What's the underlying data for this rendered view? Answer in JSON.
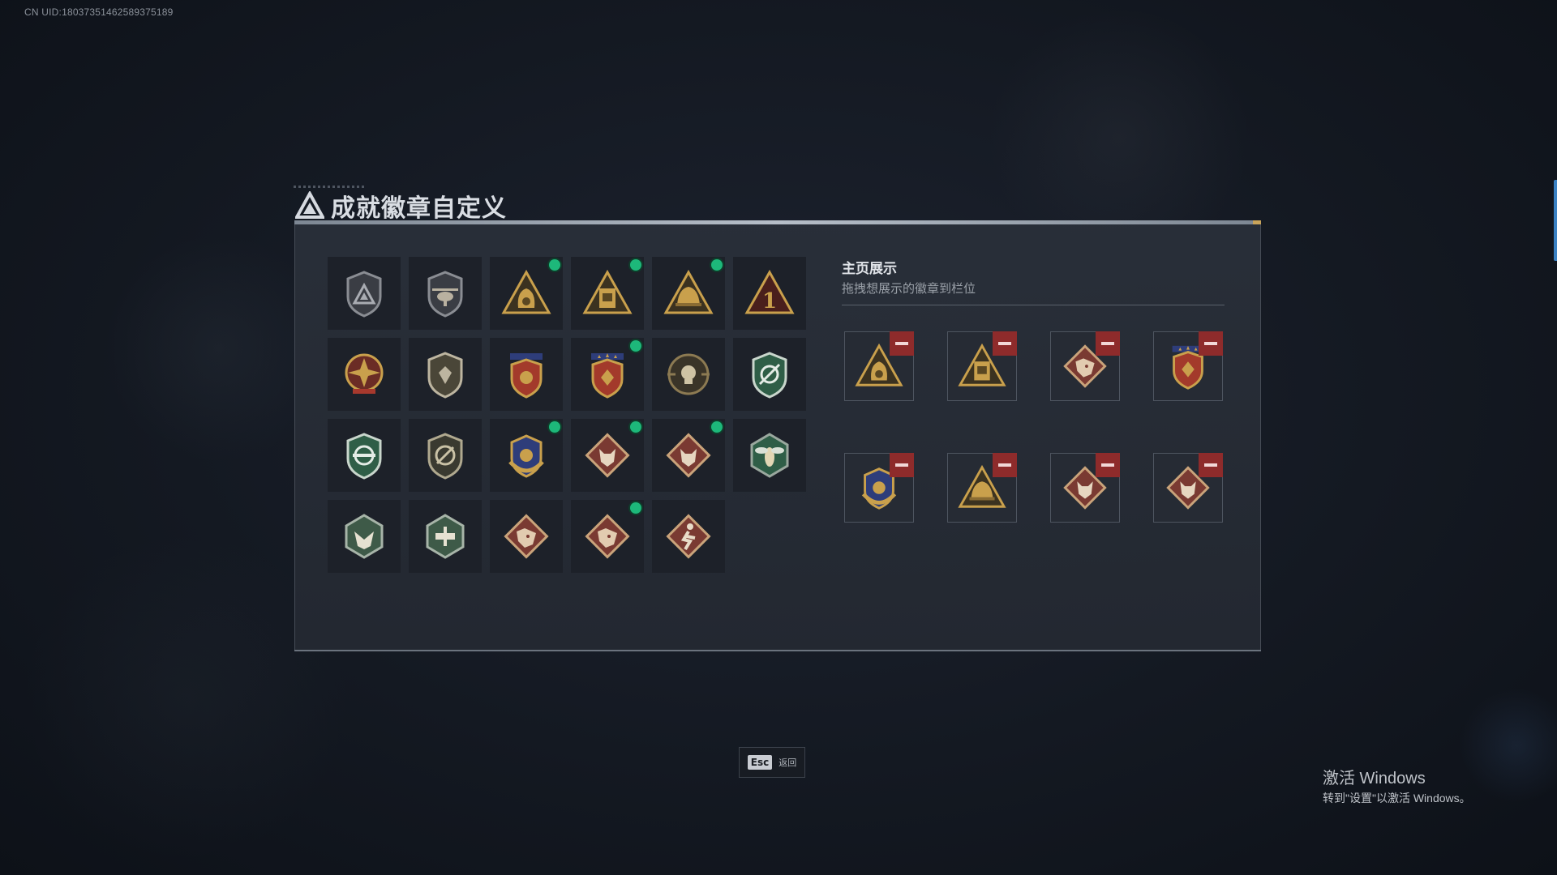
{
  "uid": "CN UID:18037351462589375189",
  "title": "成就徽章自定义",
  "showcase": {
    "title": "主页展示",
    "subtitle": "拖拽想展示的徽章到栏位"
  },
  "badges": [
    {
      "name": "badge-delta-shield",
      "icon": "delta-shield-icon",
      "new": false
    },
    {
      "name": "badge-helicopter",
      "icon": "helicopter-shield-icon",
      "new": false
    },
    {
      "name": "badge-gold-bag-55",
      "icon": "gold-bag-icon",
      "new": true
    },
    {
      "name": "badge-gold-card-57",
      "icon": "gold-card-icon",
      "new": true
    },
    {
      "name": "badge-gold-helmet",
      "icon": "gold-helmet-icon",
      "new": true
    },
    {
      "name": "badge-number-1",
      "icon": "number-one-icon",
      "new": false
    },
    {
      "name": "badge-star-medal",
      "icon": "star-medal-icon",
      "new": false
    },
    {
      "name": "badge-shield-plain",
      "icon": "silver-shield-icon",
      "new": false
    },
    {
      "name": "badge-red-shield",
      "icon": "red-shield-icon",
      "new": false
    },
    {
      "name": "badge-red-shield-stars",
      "icon": "red-star-shield-icon",
      "new": true
    },
    {
      "name": "badge-skull-target",
      "icon": "skull-target-icon",
      "new": false
    },
    {
      "name": "badge-green-crosshair",
      "icon": "green-crosshair-icon",
      "new": false
    },
    {
      "name": "badge-green-rifle",
      "icon": "green-rifle-icon",
      "new": false
    },
    {
      "name": "badge-no-scope",
      "icon": "no-scope-icon",
      "new": false
    },
    {
      "name": "badge-gold-wreath",
      "icon": "gold-wreath-icon",
      "new": true
    },
    {
      "name": "badge-wolf-1",
      "icon": "wolf-icon",
      "new": true
    },
    {
      "name": "badge-wolf-2",
      "icon": "wolf-icon",
      "new": true
    },
    {
      "name": "badge-wasp",
      "icon": "wasp-icon",
      "new": false
    },
    {
      "name": "badge-green-eagle",
      "icon": "eagle-hex-icon",
      "new": false
    },
    {
      "name": "badge-green-drone",
      "icon": "drone-hex-icon",
      "new": false
    },
    {
      "name": "badge-dragon-1",
      "icon": "dragon-icon",
      "new": false
    },
    {
      "name": "badge-dragon-2",
      "icon": "dragon-icon",
      "new": true
    },
    {
      "name": "badge-runner",
      "icon": "runner-icon",
      "new": false
    }
  ],
  "slots": [
    {
      "icon": "gold-bag-icon"
    },
    {
      "icon": "gold-card-icon"
    },
    {
      "icon": "dragon-icon"
    },
    {
      "icon": "red-star-shield-icon"
    },
    {
      "icon": "gold-wreath-icon"
    },
    {
      "icon": "gold-helmet-icon"
    },
    {
      "icon": "wolf-icon"
    },
    {
      "icon": "wolf-icon"
    }
  ],
  "footer": {
    "esc_key": "Esc",
    "esc_label": "返回"
  },
  "windows": {
    "title": "激活 Windows",
    "subtitle": "转到\"设置\"以激活 Windows。"
  },
  "colors": {
    "gold": "#c9a04c",
    "red": "#8e2b2b",
    "green": "#1db87a",
    "dark_green": "#2f5e47",
    "panel": "#2a303a"
  }
}
